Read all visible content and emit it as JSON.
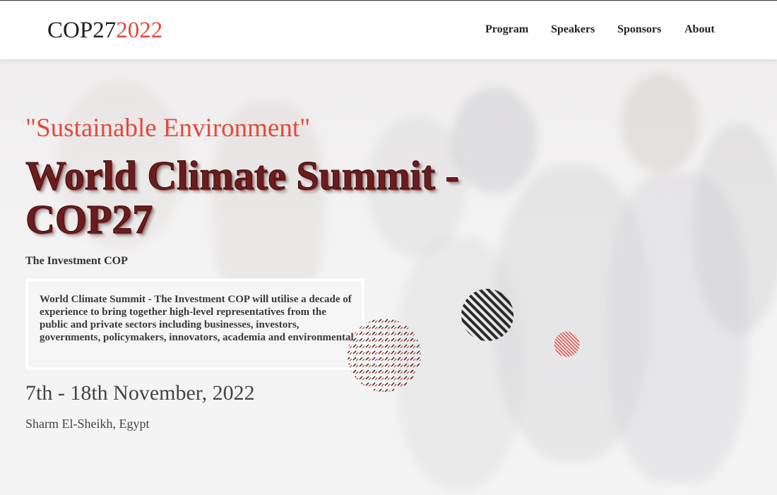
{
  "nav": {
    "logo_text": "COP27",
    "logo_year": "2022",
    "links": [
      "Program",
      "Speakers",
      "Sponsors",
      "About"
    ]
  },
  "hero": {
    "tagline": "\"Sustainable Environment\"",
    "headline": "World Climate Summit - COP27",
    "subtitle": "The Investment COP",
    "description": "World Climate Summit - The Investment COP will utilise a decade of experience to bring together high-level representatives from the public and private sectors including businesses, investors, governments, policymakers, innovators, academia and environmental",
    "dates": "7th - 18th November, 2022",
    "location": "Sharm El-Sheikh, Egypt"
  },
  "colors": {
    "accent": "#e2493d",
    "headline": "#6b1d1d",
    "text": "#222222"
  }
}
